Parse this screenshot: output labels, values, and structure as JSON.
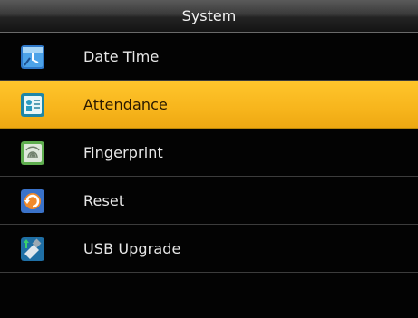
{
  "window": {
    "title": "System"
  },
  "menu": {
    "selected_index": 1,
    "items": [
      {
        "label": "Date Time",
        "icon": "calendar-clock-icon"
      },
      {
        "label": "Attendance",
        "icon": "attendance-record-icon"
      },
      {
        "label": "Fingerprint",
        "icon": "fingerprint-icon"
      },
      {
        "label": "Reset",
        "icon": "reset-icon"
      },
      {
        "label": "USB Upgrade",
        "icon": "usb-upgrade-icon"
      }
    ]
  },
  "colors": {
    "background": "#030303",
    "highlight": "#f7b51c",
    "text": "#e8e8e8",
    "selected_text": "#2a1a00"
  }
}
